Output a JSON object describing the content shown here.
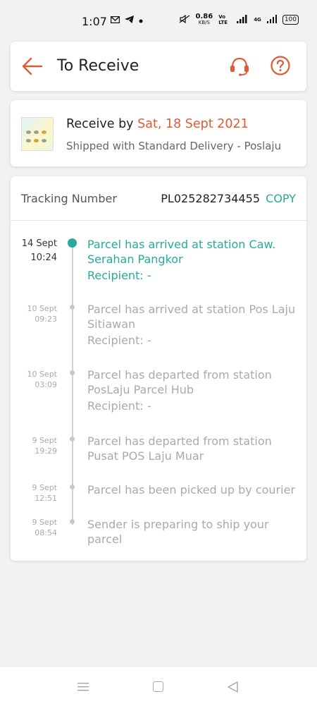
{
  "status_bar": {
    "time": "1:07",
    "net_speed": "0.86",
    "net_unit": "KB/S",
    "network_labels": [
      "Vo LTE",
      "4G"
    ],
    "battery": "100"
  },
  "header": {
    "title": "To Receive",
    "icons": [
      "back-arrow-icon",
      "headset-icon",
      "help-icon"
    ],
    "accent_color": "#e05a36"
  },
  "delivery": {
    "receive_prefix": "Receive by",
    "receive_date": "Sat, 18 Sept 2021",
    "shipping_text": "Shipped with Standard Delivery  - Poslaju"
  },
  "tracking": {
    "label": "Tracking Number",
    "number": "PL025282734455",
    "copy_label": "COPY",
    "accent_color": "#26aa99",
    "events": [
      {
        "date": "14 Sept",
        "time": "10:24",
        "text": "Parcel has arrived at station Caw. Serahan Pangkor",
        "recipient": "Recipient: -",
        "active": true
      },
      {
        "date": "10 Sept",
        "time": "09:23",
        "text": "Parcel has arrived at station Pos Laju Sitiawan",
        "recipient": "Recipient: -",
        "active": false
      },
      {
        "date": "10 Sept",
        "time": "03:09",
        "text": "Parcel has departed from station PosLaju Parcel Hub",
        "recipient": "Recipient: -",
        "active": false
      },
      {
        "date": "9 Sept",
        "time": "19:29",
        "text": "Parcel has departed from station Pusat POS Laju Muar",
        "recipient": "",
        "active": false
      },
      {
        "date": "9 Sept",
        "time": "12:51",
        "text": "Parcel has been picked up by courier",
        "recipient": "",
        "active": false
      },
      {
        "date": "9 Sept",
        "time": "08:54",
        "text": "Sender is preparing to ship your parcel",
        "recipient": "",
        "active": false
      }
    ]
  },
  "nav_bar": {
    "icons": [
      "menu-icon",
      "home-icon",
      "back-icon"
    ]
  }
}
